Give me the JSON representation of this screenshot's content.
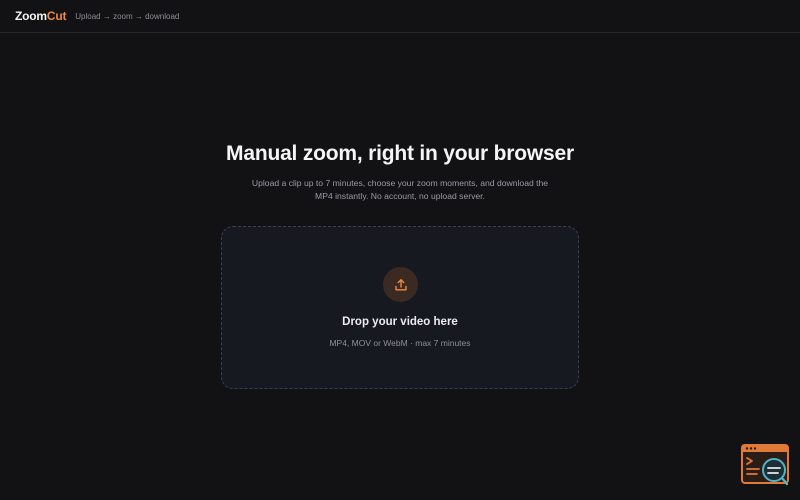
{
  "header": {
    "logo_part1": "Zoom",
    "logo_part2": "Cut",
    "tagline": "Upload → zoom → download"
  },
  "hero": {
    "title": "Manual zoom, right in your browser",
    "subtitle": "Upload a clip up to 7 minutes, choose your zoom moments, and download the MP4 instantly. No account, no upload server."
  },
  "dropzone": {
    "icon": "upload-icon",
    "title": "Drop your video here",
    "hint": "MP4, MOV or WebM · max 7 minutes"
  },
  "floating_widget": {
    "icon": "terminal-search-icon"
  },
  "colors": {
    "background": "#121215",
    "accent": "#f08a3e",
    "dropzone_bg": "#161920",
    "dropzone_border": "#3b3f49"
  }
}
